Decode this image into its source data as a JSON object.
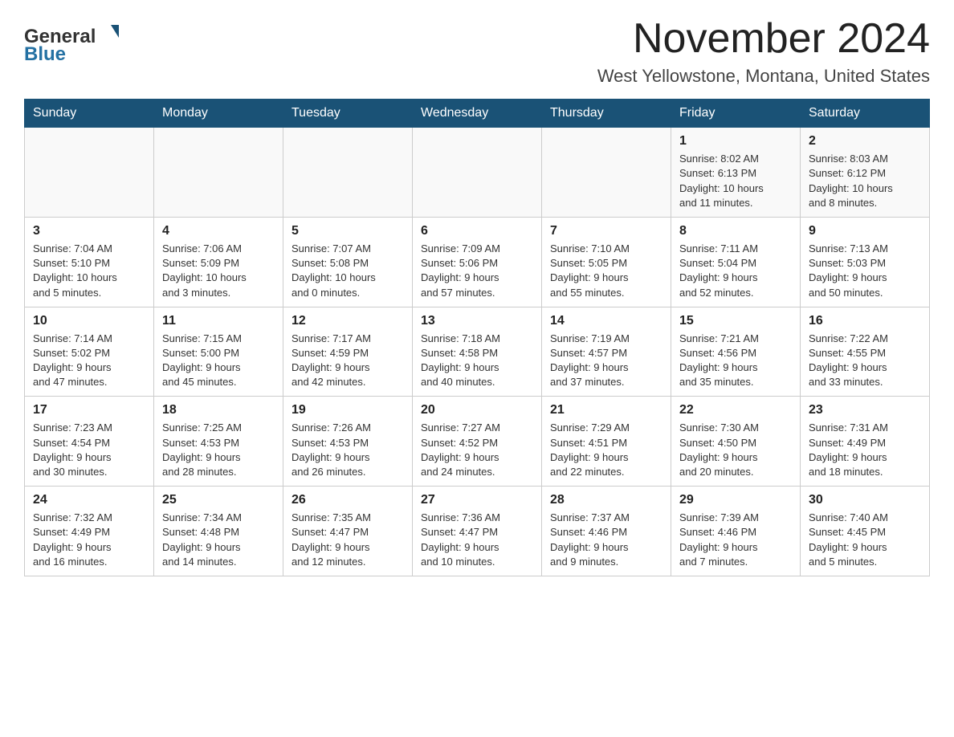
{
  "header": {
    "logo_general": "General",
    "logo_blue": "Blue",
    "month_title": "November 2024",
    "location": "West Yellowstone, Montana, United States"
  },
  "weekdays": [
    "Sunday",
    "Monday",
    "Tuesday",
    "Wednesday",
    "Thursday",
    "Friday",
    "Saturday"
  ],
  "weeks": [
    [
      {
        "day": "",
        "info": ""
      },
      {
        "day": "",
        "info": ""
      },
      {
        "day": "",
        "info": ""
      },
      {
        "day": "",
        "info": ""
      },
      {
        "day": "",
        "info": ""
      },
      {
        "day": "1",
        "info": "Sunrise: 8:02 AM\nSunset: 6:13 PM\nDaylight: 10 hours\nand 11 minutes."
      },
      {
        "day": "2",
        "info": "Sunrise: 8:03 AM\nSunset: 6:12 PM\nDaylight: 10 hours\nand 8 minutes."
      }
    ],
    [
      {
        "day": "3",
        "info": "Sunrise: 7:04 AM\nSunset: 5:10 PM\nDaylight: 10 hours\nand 5 minutes."
      },
      {
        "day": "4",
        "info": "Sunrise: 7:06 AM\nSunset: 5:09 PM\nDaylight: 10 hours\nand 3 minutes."
      },
      {
        "day": "5",
        "info": "Sunrise: 7:07 AM\nSunset: 5:08 PM\nDaylight: 10 hours\nand 0 minutes."
      },
      {
        "day": "6",
        "info": "Sunrise: 7:09 AM\nSunset: 5:06 PM\nDaylight: 9 hours\nand 57 minutes."
      },
      {
        "day": "7",
        "info": "Sunrise: 7:10 AM\nSunset: 5:05 PM\nDaylight: 9 hours\nand 55 minutes."
      },
      {
        "day": "8",
        "info": "Sunrise: 7:11 AM\nSunset: 5:04 PM\nDaylight: 9 hours\nand 52 minutes."
      },
      {
        "day": "9",
        "info": "Sunrise: 7:13 AM\nSunset: 5:03 PM\nDaylight: 9 hours\nand 50 minutes."
      }
    ],
    [
      {
        "day": "10",
        "info": "Sunrise: 7:14 AM\nSunset: 5:02 PM\nDaylight: 9 hours\nand 47 minutes."
      },
      {
        "day": "11",
        "info": "Sunrise: 7:15 AM\nSunset: 5:00 PM\nDaylight: 9 hours\nand 45 minutes."
      },
      {
        "day": "12",
        "info": "Sunrise: 7:17 AM\nSunset: 4:59 PM\nDaylight: 9 hours\nand 42 minutes."
      },
      {
        "day": "13",
        "info": "Sunrise: 7:18 AM\nSunset: 4:58 PM\nDaylight: 9 hours\nand 40 minutes."
      },
      {
        "day": "14",
        "info": "Sunrise: 7:19 AM\nSunset: 4:57 PM\nDaylight: 9 hours\nand 37 minutes."
      },
      {
        "day": "15",
        "info": "Sunrise: 7:21 AM\nSunset: 4:56 PM\nDaylight: 9 hours\nand 35 minutes."
      },
      {
        "day": "16",
        "info": "Sunrise: 7:22 AM\nSunset: 4:55 PM\nDaylight: 9 hours\nand 33 minutes."
      }
    ],
    [
      {
        "day": "17",
        "info": "Sunrise: 7:23 AM\nSunset: 4:54 PM\nDaylight: 9 hours\nand 30 minutes."
      },
      {
        "day": "18",
        "info": "Sunrise: 7:25 AM\nSunset: 4:53 PM\nDaylight: 9 hours\nand 28 minutes."
      },
      {
        "day": "19",
        "info": "Sunrise: 7:26 AM\nSunset: 4:53 PM\nDaylight: 9 hours\nand 26 minutes."
      },
      {
        "day": "20",
        "info": "Sunrise: 7:27 AM\nSunset: 4:52 PM\nDaylight: 9 hours\nand 24 minutes."
      },
      {
        "day": "21",
        "info": "Sunrise: 7:29 AM\nSunset: 4:51 PM\nDaylight: 9 hours\nand 22 minutes."
      },
      {
        "day": "22",
        "info": "Sunrise: 7:30 AM\nSunset: 4:50 PM\nDaylight: 9 hours\nand 20 minutes."
      },
      {
        "day": "23",
        "info": "Sunrise: 7:31 AM\nSunset: 4:49 PM\nDaylight: 9 hours\nand 18 minutes."
      }
    ],
    [
      {
        "day": "24",
        "info": "Sunrise: 7:32 AM\nSunset: 4:49 PM\nDaylight: 9 hours\nand 16 minutes."
      },
      {
        "day": "25",
        "info": "Sunrise: 7:34 AM\nSunset: 4:48 PM\nDaylight: 9 hours\nand 14 minutes."
      },
      {
        "day": "26",
        "info": "Sunrise: 7:35 AM\nSunset: 4:47 PM\nDaylight: 9 hours\nand 12 minutes."
      },
      {
        "day": "27",
        "info": "Sunrise: 7:36 AM\nSunset: 4:47 PM\nDaylight: 9 hours\nand 10 minutes."
      },
      {
        "day": "28",
        "info": "Sunrise: 7:37 AM\nSunset: 4:46 PM\nDaylight: 9 hours\nand 9 minutes."
      },
      {
        "day": "29",
        "info": "Sunrise: 7:39 AM\nSunset: 4:46 PM\nDaylight: 9 hours\nand 7 minutes."
      },
      {
        "day": "30",
        "info": "Sunrise: 7:40 AM\nSunset: 4:45 PM\nDaylight: 9 hours\nand 5 minutes."
      }
    ]
  ]
}
